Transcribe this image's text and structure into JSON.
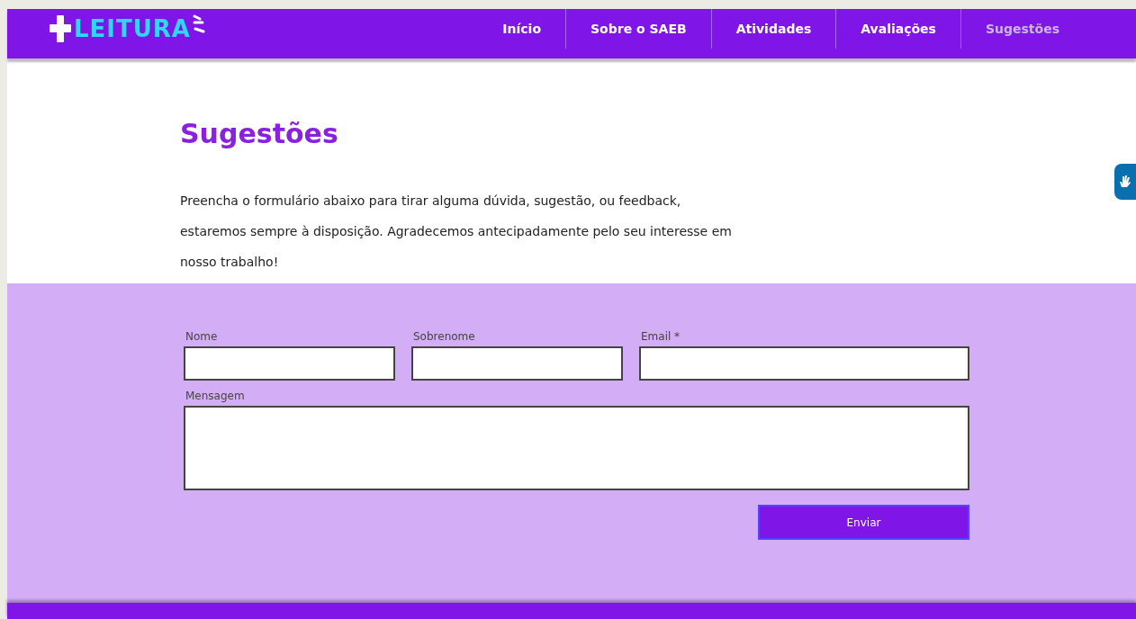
{
  "logo": {
    "text": "LEITURA"
  },
  "nav": [
    {
      "label": "Início",
      "selected": false
    },
    {
      "label": "Sobre o SAEB",
      "selected": false
    },
    {
      "label": "Atividades",
      "selected": false
    },
    {
      "label": "Avaliações",
      "selected": false
    },
    {
      "label": "Sugestões",
      "selected": true
    }
  ],
  "page": {
    "title": "Sugestões",
    "intro": "Preencha o formulário abaixo para tirar alguma dúvida, sugestão, ou feedback, estaremos sempre à disposição. Agradecemos antecipadamente pelo seu interesse em nosso trabalho!"
  },
  "form": {
    "fields": [
      {
        "label": "Nome",
        "kind": "short"
      },
      {
        "label": "Sobrenome",
        "kind": "short"
      },
      {
        "label": "Email *",
        "kind": "wide"
      },
      {
        "label": "Mensagem",
        "kind": "area"
      }
    ],
    "submit": "Enviar"
  }
}
